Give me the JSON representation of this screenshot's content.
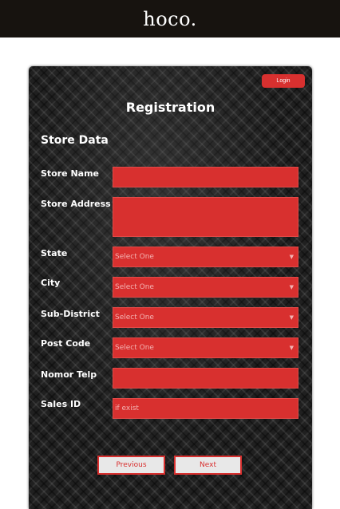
{
  "header": {
    "brand": "hoco."
  },
  "card": {
    "login_label": "Login",
    "title": "Registration",
    "section_title": "Store Data"
  },
  "form": {
    "store_name": {
      "label": "Store Name",
      "value": ""
    },
    "store_address": {
      "label": "Store Address",
      "value": ""
    },
    "state": {
      "label": "State",
      "selected": "Select One"
    },
    "city": {
      "label": "City",
      "selected": "Select One"
    },
    "sub_district": {
      "label": "Sub-District",
      "selected": "Select One"
    },
    "post_code": {
      "label": "Post Code",
      "selected": "Select One"
    },
    "nomor_telp": {
      "label": "Nomor Telp",
      "value": ""
    },
    "sales_id": {
      "label": "Sales ID",
      "placeholder": "if exist"
    }
  },
  "nav": {
    "previous_label": "Previous",
    "next_label": "Next"
  },
  "colors": {
    "accent": "#d8302f",
    "topbar": "#17130f",
    "card_bg": "#202020"
  },
  "icons": {
    "select_caret": "chevron-down-icon"
  }
}
